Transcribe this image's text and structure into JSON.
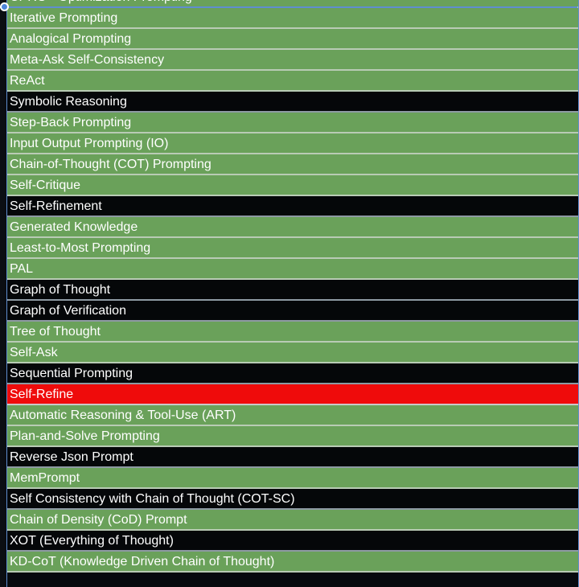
{
  "items": [
    {
      "label": "CPRO - Optimization Prompting",
      "style": "green"
    },
    {
      "label": "Iterative Prompting",
      "style": "green"
    },
    {
      "label": "Analogical Prompting",
      "style": "green"
    },
    {
      "label": "Meta-Ask Self-Consistency",
      "style": "green"
    },
    {
      "label": "ReAct",
      "style": "green"
    },
    {
      "label": "Symbolic Reasoning",
      "style": "black"
    },
    {
      "label": "Step-Back Prompting",
      "style": "green"
    },
    {
      "label": "Input Output Prompting (IO)",
      "style": "green"
    },
    {
      "label": "Chain-of-Thought (COT) Prompting",
      "style": "green"
    },
    {
      "label": "Self-Critique",
      "style": "green"
    },
    {
      "label": "Self-Refinement",
      "style": "black"
    },
    {
      "label": "Generated Knowledge",
      "style": "green"
    },
    {
      "label": "Least-to-Most Prompting",
      "style": "green"
    },
    {
      "label": "PAL",
      "style": "green"
    },
    {
      "label": "Graph of Thought",
      "style": "black"
    },
    {
      "label": "Graph of Verification",
      "style": "black"
    },
    {
      "label": "Tree of Thought",
      "style": "green"
    },
    {
      "label": "Self-Ask",
      "style": "green"
    },
    {
      "label": "Sequential Prompting",
      "style": "black"
    },
    {
      "label": "Self-Refine",
      "style": "red"
    },
    {
      "label": "Automatic Reasoning & Tool-Use (ART)",
      "style": "green"
    },
    {
      "label": "Plan-and-Solve Prompting",
      "style": "green"
    },
    {
      "label": "Reverse Json Prompt",
      "style": "black"
    },
    {
      "label": "MemPrompt",
      "style": "green"
    },
    {
      "label": "Self Consistency with Chain of Thought (COT-SC)",
      "style": "black"
    },
    {
      "label": "Chain of Density (CoD) Prompt",
      "style": "green"
    },
    {
      "label": "XOT (Everything of Thought)",
      "style": "black"
    },
    {
      "label": "KD-CoT (Knowledge Driven Chain of Thought)",
      "style": "green"
    }
  ],
  "colors": {
    "green": "#6aa15a",
    "black": "#050709",
    "red": "#ef0b0b",
    "selection": "#5f8ed0"
  }
}
